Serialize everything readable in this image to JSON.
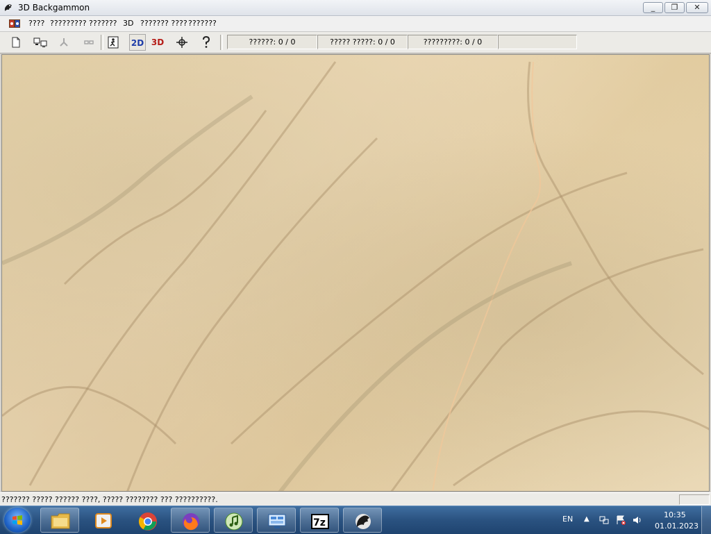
{
  "window": {
    "title": "3D Backgammon",
    "minimize": "_",
    "maximize": "❐",
    "close": "✕"
  },
  "menu": {
    "items": [
      "????",
      "????????? ????",
      "???",
      "3D",
      "??????? ????",
      "???????"
    ]
  },
  "toolbar": {
    "labels_2d": "2D",
    "labels_3d": "3D",
    "fields": [
      "??????: 0 / 0",
      "????? ?????: 0 / 0",
      "?????????: 0 / 0",
      ""
    ]
  },
  "statusbar": {
    "text": "??????? ????? ?????? ????, ????? ???????? ??? ??????????."
  },
  "taskbar": {
    "lang": "EN",
    "time": "10:35",
    "date": "01.01.2023"
  },
  "colors": {
    "marble_base": "#e5d2aa",
    "vein": "#a88d68",
    "taskbar": "#2a5280"
  }
}
